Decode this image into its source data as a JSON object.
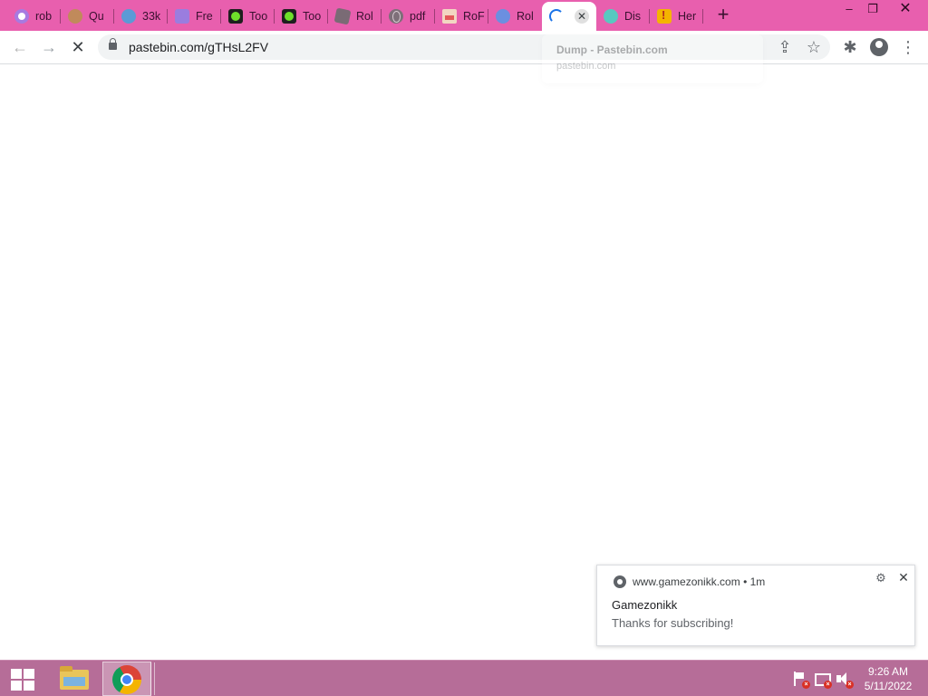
{
  "browser": {
    "tabs": [
      {
        "label": "rob",
        "icon": "chrome-swirl-icon"
      },
      {
        "label": "Qu",
        "icon": "avatar-icon"
      },
      {
        "label": "33k",
        "icon": "meteor-icon"
      },
      {
        "label": "Fre",
        "icon": "book-icon"
      },
      {
        "label": "Too",
        "icon": "green-gear-icon"
      },
      {
        "label": "Too",
        "icon": "green-gear-icon"
      },
      {
        "label": "Rol",
        "icon": "roblox-icon"
      },
      {
        "label": "pdf",
        "icon": "globe-icon"
      },
      {
        "label": "RoF",
        "icon": "image-icon"
      },
      {
        "label": "Rol",
        "icon": "ball-icon"
      },
      {
        "label": "",
        "icon": "loading-spinner-icon",
        "active": true
      },
      {
        "label": "Dis",
        "icon": "discord-icon"
      },
      {
        "label": "Her",
        "icon": "warning-icon"
      }
    ],
    "active_tab_close": "✕",
    "new_tab": "+",
    "url": "pastebin.com/gTHsL2FV",
    "hover_card": {
      "title": "Dump - Pastebin.com",
      "url": "pastebin.com"
    },
    "window_controls": {
      "minimize": "–",
      "maximize": "❐",
      "close": "✕"
    },
    "toolbar_icons": {
      "back": "←",
      "forward": "→",
      "stop": "✕",
      "share": "⇪",
      "star": "☆",
      "extensions": "✱",
      "menu": "⋮"
    }
  },
  "notification": {
    "source": "www.gamezonikk.com",
    "separator": "•",
    "age": "1m",
    "title": "Gamezonikk",
    "message": "Thanks for subscribing!",
    "gear": "⚙",
    "close": "✕"
  },
  "taskbar": {
    "time": "9:26 AM",
    "date": "5/11/2022",
    "tray_badge": "×"
  },
  "colors": {
    "tabstrip": "#e85fae",
    "taskbar": "#b66d98",
    "spinner": "#1a73e8"
  }
}
